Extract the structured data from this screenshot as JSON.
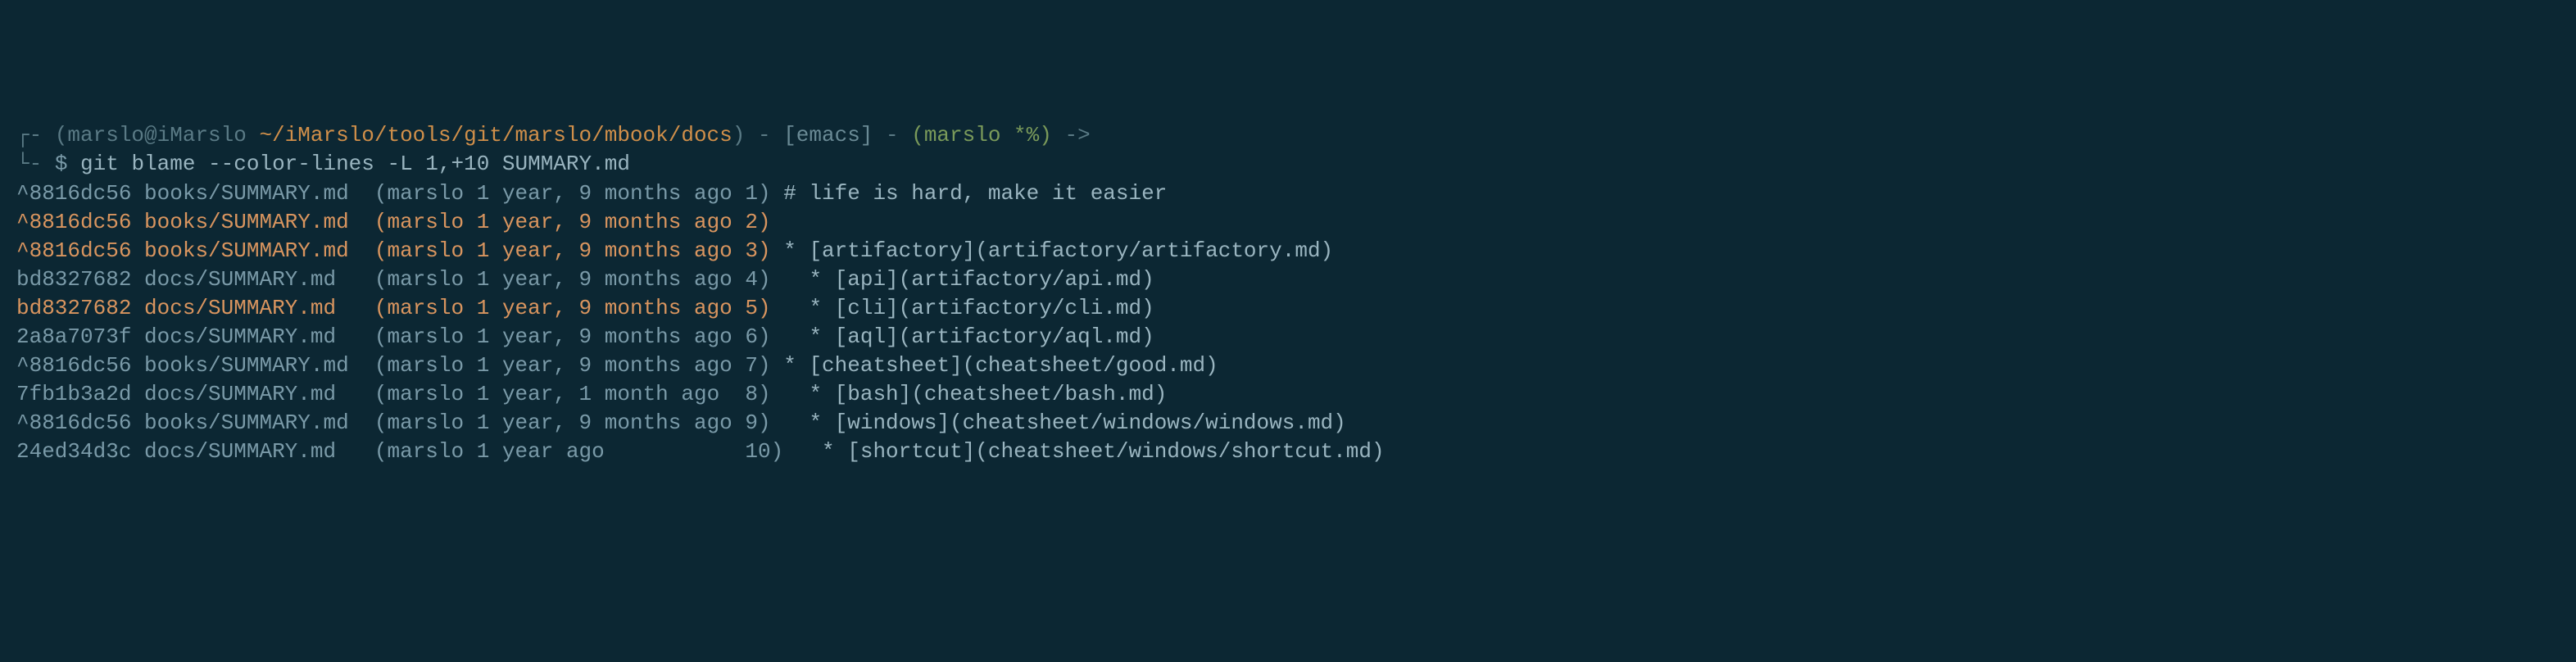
{
  "prompt": {
    "user_host": "(marslo@iMarslo ",
    "path": "~/iMarslo/tools/git/marslo/mbook/docs",
    "closer": ") ",
    "separator1": "- ",
    "mode": "[emacs]",
    "separator2": " - ",
    "branch": "(marslo *%)",
    "arrow": " ->",
    "prompt_char": "$ ",
    "command": "git blame --color-lines -L 1,+10 SUMMARY.md"
  },
  "blame": [
    {
      "commit": "^8816dc56",
      "file": "books/SUMMARY.md",
      "author": "marslo",
      "date": "1 year, 9 months ago",
      "line": "1",
      "content": "# life is hard, make it easier",
      "highlight": false,
      "caret": true
    },
    {
      "commit": "^8816dc56",
      "file": "books/SUMMARY.md",
      "author": "marslo",
      "date": "1 year, 9 months ago",
      "line": "2",
      "content": "",
      "highlight": true,
      "caret": true
    },
    {
      "commit": "^8816dc56",
      "file": "books/SUMMARY.md",
      "author": "marslo",
      "date": "1 year, 9 months ago",
      "line": "3",
      "content": "* [artifactory](artifactory/artifactory.md)",
      "highlight": true,
      "caret": true
    },
    {
      "commit": "bd8327682",
      "file": "docs/SUMMARY.md ",
      "author": "marslo",
      "date": "1 year, 9 months ago",
      "line": "4",
      "content": "  * [api](artifactory/api.md)",
      "highlight": false,
      "caret": false
    },
    {
      "commit": "bd8327682",
      "file": "docs/SUMMARY.md ",
      "author": "marslo",
      "date": "1 year, 9 months ago",
      "line": "5",
      "content": "  * [cli](artifactory/cli.md)",
      "highlight": true,
      "caret": false
    },
    {
      "commit": "2a8a7073f",
      "file": "docs/SUMMARY.md ",
      "author": "marslo",
      "date": "1 year, 9 months ago",
      "line": "6",
      "content": "  * [aql](artifactory/aql.md)",
      "highlight": false,
      "caret": false
    },
    {
      "commit": "^8816dc56",
      "file": "books/SUMMARY.md",
      "author": "marslo",
      "date": "1 year, 9 months ago",
      "line": "7",
      "content": "* [cheatsheet](cheatsheet/good.md)",
      "highlight": false,
      "caret": true
    },
    {
      "commit": "7fb1b3a2d",
      "file": "docs/SUMMARY.md ",
      "author": "marslo",
      "date": "1 year, 1 month ago ",
      "line": "8",
      "content": "  * [bash](cheatsheet/bash.md)",
      "highlight": false,
      "caret": false
    },
    {
      "commit": "^8816dc56",
      "file": "books/SUMMARY.md",
      "author": "marslo",
      "date": "1 year, 9 months ago",
      "line": "9",
      "content": "  * [windows](cheatsheet/windows/windows.md)",
      "highlight": false,
      "caret": true
    },
    {
      "commit": "24ed34d3c",
      "file": "docs/SUMMARY.md ",
      "author": "marslo",
      "date": "1 year ago          ",
      "line": "10",
      "content": "  * [shortcut](cheatsheet/windows/shortcut.md)",
      "highlight": false,
      "caret": false
    }
  ]
}
